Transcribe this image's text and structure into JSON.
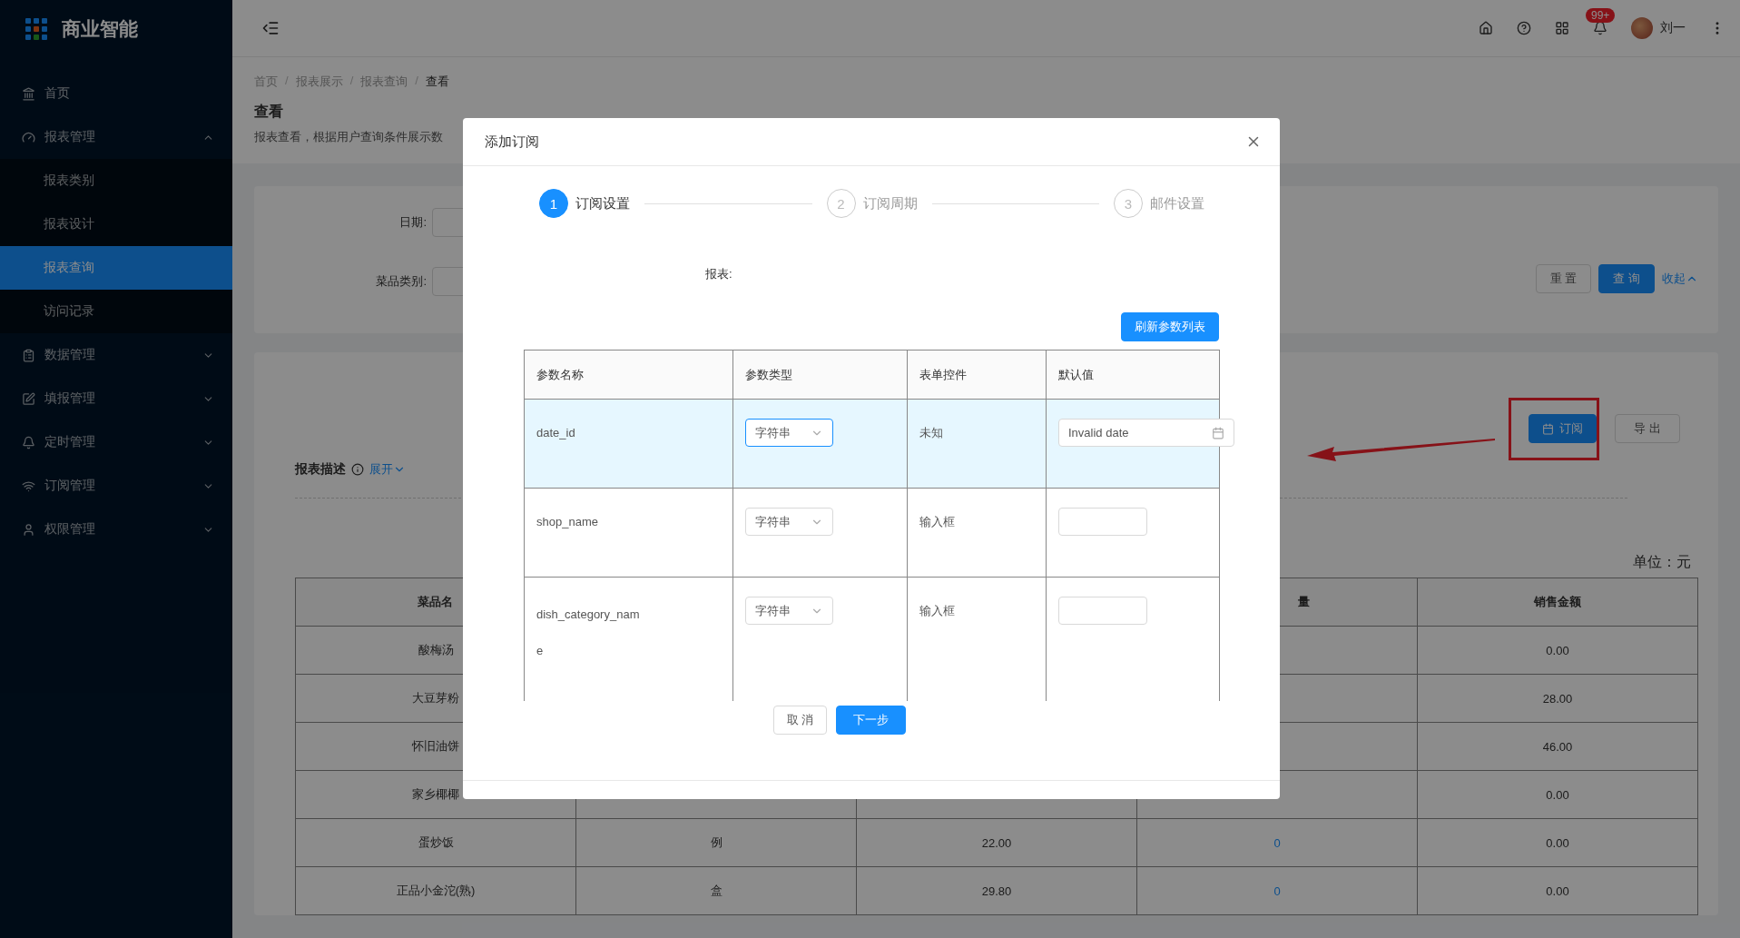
{
  "sidebar": {
    "logo": "商业智能",
    "items": [
      {
        "label": "首页",
        "kind": "link"
      },
      {
        "label": "报表管理",
        "kind": "submenu",
        "expanded": true,
        "children": [
          {
            "label": "报表类别",
            "selected": false
          },
          {
            "label": "报表设计",
            "selected": false
          },
          {
            "label": "报表查询",
            "selected": true
          },
          {
            "label": "访问记录",
            "selected": false
          }
        ]
      },
      {
        "label": "数据管理",
        "kind": "submenu",
        "expanded": false
      },
      {
        "label": "填报管理",
        "kind": "submenu",
        "expanded": false
      },
      {
        "label": "定时管理",
        "kind": "submenu",
        "expanded": false
      },
      {
        "label": "订阅管理",
        "kind": "submenu",
        "expanded": false
      },
      {
        "label": "权限管理",
        "kind": "submenu",
        "expanded": false
      }
    ]
  },
  "header": {
    "notification_badge": "99+",
    "user_name": "刘一"
  },
  "breadcrumb": [
    "首页",
    "报表展示",
    "报表查询",
    "查看"
  ],
  "breadcrumb_separator": "/",
  "page": {
    "title": "查看",
    "description": "报表查看，根据用户查询条件展示数"
  },
  "filters": {
    "fields": [
      {
        "label": "日期:"
      },
      {
        "label": "菜品类别:"
      }
    ],
    "buttons": [
      "重 置",
      "查 询"
    ],
    "collapse_link": "收起"
  },
  "report": {
    "buttons": [
      "订阅",
      "导 出"
    ],
    "description_label": "报表描述",
    "expand_link": "展开",
    "unit": "单位：元",
    "columns": [
      {
        "label": "菜品名"
      },
      {},
      {},
      {
        "label": "量"
      },
      {
        "label": "销售金额"
      }
    ],
    "rows": [
      {
        "name": "酸梅汤",
        "amount": "0.00"
      },
      {
        "name": "大豆芽粉",
        "amount": "28.00"
      },
      {
        "name": "怀旧油饼",
        "amount": "46.00"
      },
      {
        "name": "家乡椰椰",
        "amount": "0.00"
      },
      {
        "name": "蛋炒饭",
        "column_2": "例",
        "column_3": "22.00",
        "column_4": "0",
        "amount": "0.00"
      },
      {
        "name": "正品小金沱(熟)",
        "column_2": "盒",
        "column_3": "29.80",
        "column_4": "0",
        "amount": "0.00"
      }
    ]
  },
  "modal": {
    "title": "添加订阅",
    "steps": [
      {
        "number": "1",
        "label": "订阅设置",
        "selected": true
      },
      {
        "number": "2",
        "label": "订阅周期",
        "selected": false
      },
      {
        "number": "3",
        "label": "邮件设置",
        "selected": false
      }
    ],
    "report_label": "报表:",
    "refresh_button": "刷新参数列表",
    "columns": [
      "参数名称",
      "参数类型",
      "表单控件",
      "默认值"
    ],
    "rows": [
      {
        "name": "date_id",
        "type": "字符串",
        "control": "未知",
        "kind": "date",
        "value": "Invalid date",
        "selected": true
      },
      {
        "name": "shop_name",
        "type": "字符串",
        "control": "输入框",
        "kind": "text",
        "selected": false
      },
      {
        "name": "dish_category_name",
        "type": "字符串",
        "control": "输入框",
        "kind": "text",
        "selected": false
      }
    ],
    "buttons": [
      "取 消",
      "下一步"
    ]
  }
}
